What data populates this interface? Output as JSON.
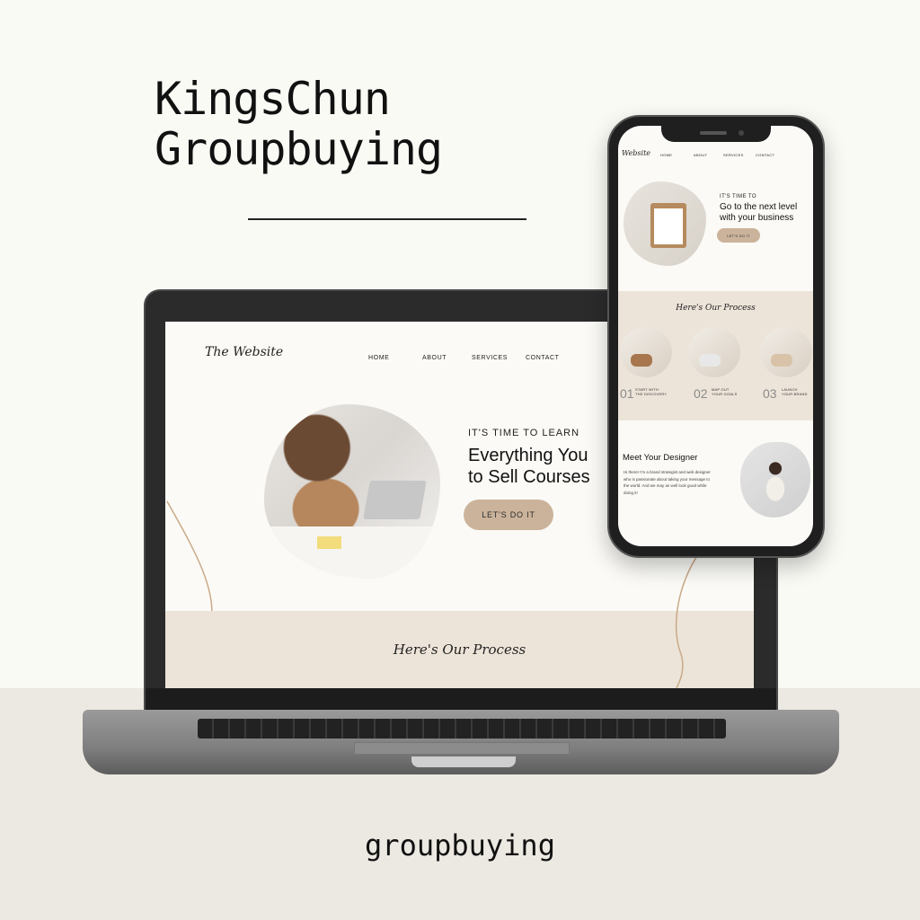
{
  "poster": {
    "title_line1": "KingsChun",
    "title_line2": "Groupbuying",
    "footer_word": "groupbuying"
  },
  "laptop_site": {
    "logo": "The Website",
    "nav": [
      "HOME",
      "ABOUT",
      "SERVICES",
      "CONTACT"
    ],
    "hero": {
      "eyebrow": "IT'S TIME TO LEARN",
      "heading": "Everything You\nto Sell Courses",
      "cta": "LET'S DO IT"
    },
    "process_title": "Here's Our Process"
  },
  "phone_site": {
    "logo": "Website",
    "nav": [
      "HOME",
      "ABOUT",
      "SERVICES",
      "CONTACT"
    ],
    "hero": {
      "eyebrow": "IT'S TIME TO",
      "heading": "Go to the next level\nwith your business",
      "cta": "LET'S DO IT"
    },
    "process_title": "Here's Our Process",
    "steps": [
      {
        "num": "01",
        "label": "START WITH\nTHE DISCOVERY"
      },
      {
        "num": "02",
        "label": "MAP OUT\nYOUR GOALS"
      },
      {
        "num": "03",
        "label": "LAUNCH\nYOUR BRAND"
      }
    ],
    "designer": {
      "title": "Meet Your Designer",
      "text": "Hi there! I'm a brand strategist and web designer who is passionate about taking your message to the world. And we may as well look good while doing it!"
    }
  },
  "colors": {
    "background": "#fafaf5",
    "floor": "#ece8e2",
    "accent_tan": "#cbb39b",
    "band_beige": "#ede4d9"
  }
}
